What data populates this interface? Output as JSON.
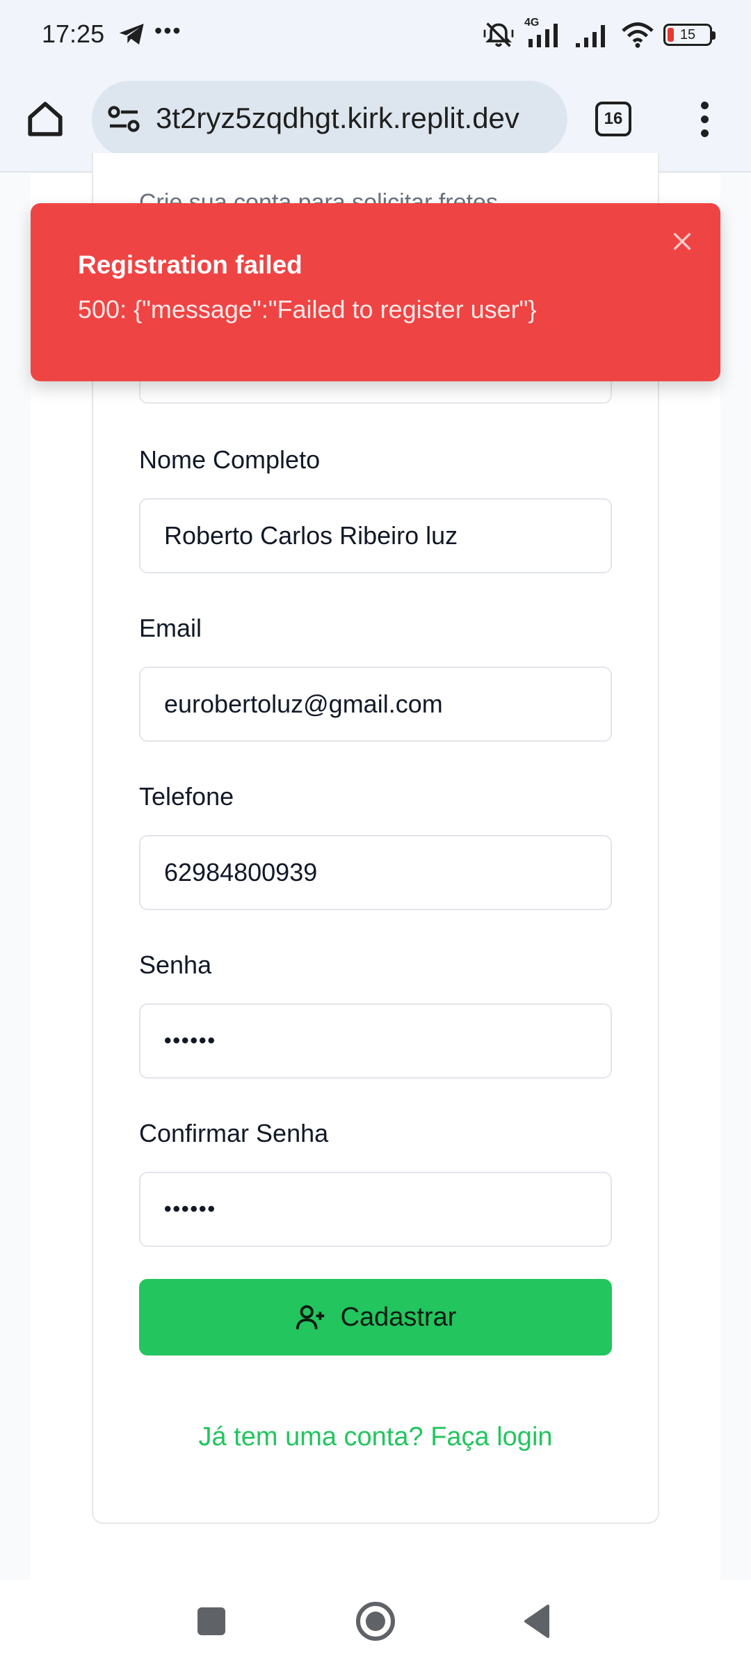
{
  "status_bar": {
    "time": "17:25",
    "network": "4G",
    "battery": "15",
    "icons": [
      "telegram-icon",
      "more-dots-icon",
      "vibrate-mute-icon",
      "signal-icon",
      "wifi-icon",
      "battery-icon"
    ]
  },
  "browser": {
    "url": "3t2ryz5zqdhgt.kirk.replit.dev",
    "tab_count": "16"
  },
  "form": {
    "subtitle": "Crie sua conta para solicitar fretes",
    "fields": [
      {
        "label": "Nome Completo",
        "value": "Roberto Carlos Ribeiro luz"
      },
      {
        "label": "Email",
        "value": "eurobertoluz@gmail.com"
      },
      {
        "label": "Telefone",
        "value": "62984800939"
      },
      {
        "label": "Senha",
        "value": "••••••"
      },
      {
        "label": "Confirmar Senha",
        "value": "••••••"
      }
    ],
    "submit_label": "Cadastrar",
    "login_link": "Já tem uma conta? Faça login"
  },
  "toast": {
    "title": "Registration failed",
    "message": "500: {\"message\":\"Failed to register user\"}",
    "color": "#ef4444"
  },
  "theme": {
    "accent": "#22c55e",
    "error": "#ef4444"
  }
}
